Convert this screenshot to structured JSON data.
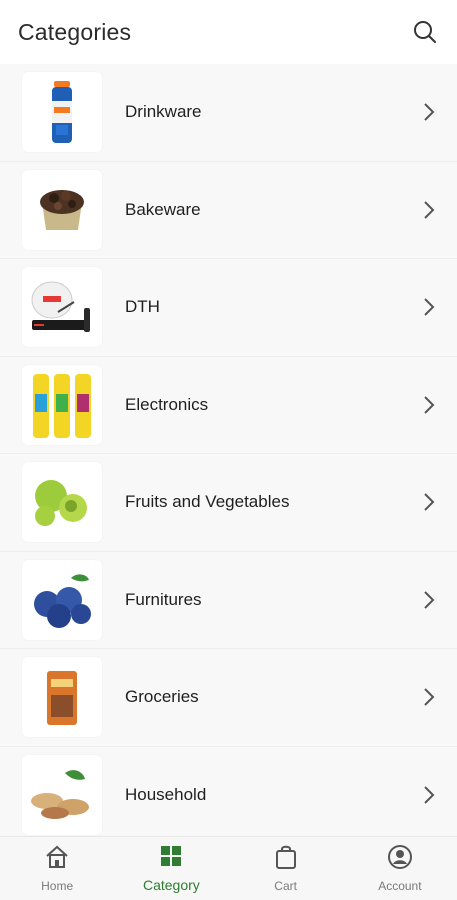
{
  "header": {
    "title": "Categories",
    "search_icon": "search-icon"
  },
  "categories": [
    {
      "label": "Drinkware",
      "image": "drink-bottle"
    },
    {
      "label": "Bakeware",
      "image": "chocolate-pastry"
    },
    {
      "label": "DTH",
      "image": "satellite-dish"
    },
    {
      "label": "Electronics",
      "image": "spray-cans"
    },
    {
      "label": "Fruits and Vegetables",
      "image": "gooseberries"
    },
    {
      "label": "Furnitures",
      "image": "blueberries"
    },
    {
      "label": "Groceries",
      "image": "grocery-pack"
    },
    {
      "label": "Household",
      "image": "peanuts"
    }
  ],
  "nav": {
    "home": "Home",
    "category": "Category",
    "cart": "Cart",
    "account": "Account",
    "active": "Category"
  },
  "colors": {
    "accent": "#2e7d32",
    "inactive": "#7a7a7a"
  }
}
